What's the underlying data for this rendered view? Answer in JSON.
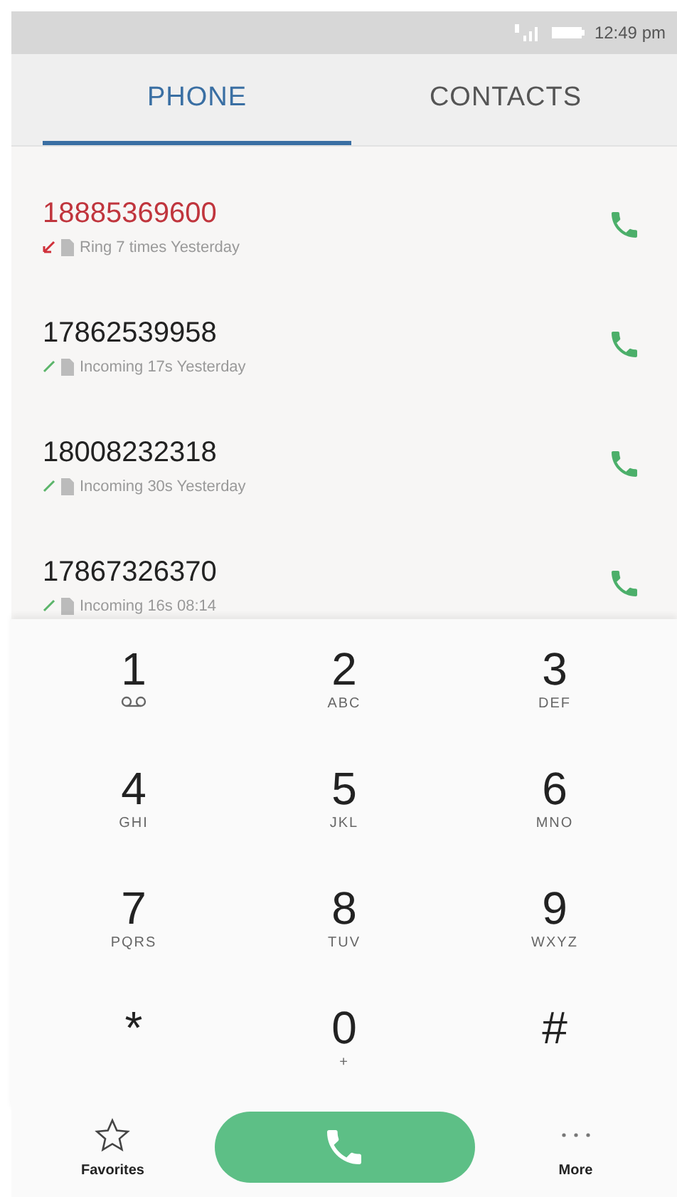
{
  "status_bar": {
    "time": "12:49 pm"
  },
  "tabs": [
    {
      "label": "PHONE",
      "selected": true
    },
    {
      "label": "CONTACTS",
      "selected": false
    }
  ],
  "call_log": [
    {
      "number": "18885369600",
      "kind": "missed",
      "detail": "Ring 7 times Yesterday"
    },
    {
      "number": "17862539958",
      "kind": "incoming",
      "detail": "Incoming 17s Yesterday"
    },
    {
      "number": "18008232318",
      "kind": "incoming",
      "detail": "Incoming 30s Yesterday"
    },
    {
      "number": "17867326370",
      "kind": "incoming",
      "detail": "Incoming 16s 08:14"
    }
  ],
  "dialpad": [
    {
      "digit": "1",
      "kind": "voicemail"
    },
    {
      "digit": "2",
      "letters": "ABC"
    },
    {
      "digit": "3",
      "letters": "DEF"
    },
    {
      "digit": "4",
      "letters": "GHI"
    },
    {
      "digit": "5",
      "letters": "JKL"
    },
    {
      "digit": "6",
      "letters": "MNO"
    },
    {
      "digit": "7",
      "letters": "PQRS"
    },
    {
      "digit": "8",
      "letters": "TUV"
    },
    {
      "digit": "9",
      "letters": "WXYZ"
    },
    {
      "digit": "*"
    },
    {
      "digit": "0",
      "letters": "+"
    },
    {
      "digit": "#"
    }
  ],
  "bottom_bar": {
    "left": "Favorites",
    "right": "More"
  }
}
